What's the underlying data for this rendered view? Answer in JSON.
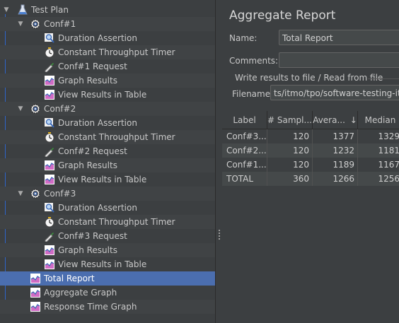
{
  "tree": {
    "items": [
      {
        "label": "Test Plan",
        "icon": "flask-icon",
        "level": 0,
        "expanded": true
      },
      {
        "label": "Conf#1",
        "icon": "gear-icon",
        "level": 1,
        "expanded": true
      },
      {
        "label": "Duration Assertion",
        "icon": "magnifier-icon",
        "level": 2
      },
      {
        "label": "Constant Throughput Timer",
        "icon": "stopwatch-icon",
        "level": 2
      },
      {
        "label": "Conf#1 Request",
        "icon": "pipette-icon",
        "level": 2
      },
      {
        "label": "Graph Results",
        "icon": "graph-icon",
        "level": 2
      },
      {
        "label": "View Results in Table",
        "icon": "graph-icon",
        "level": 2
      },
      {
        "label": "Conf#2",
        "icon": "gear-icon",
        "level": 1,
        "expanded": true
      },
      {
        "label": "Duration Assertion",
        "icon": "magnifier-icon",
        "level": 2
      },
      {
        "label": "Constant Throughput Timer",
        "icon": "stopwatch-icon",
        "level": 2
      },
      {
        "label": "Conf#2 Request",
        "icon": "pipette-icon",
        "level": 2
      },
      {
        "label": "Graph Results",
        "icon": "graph-icon",
        "level": 2
      },
      {
        "label": "View Results in Table",
        "icon": "graph-icon",
        "level": 2
      },
      {
        "label": "Conf#3",
        "icon": "gear-icon",
        "level": 1,
        "expanded": true
      },
      {
        "label": "Duration Assertion",
        "icon": "magnifier-icon",
        "level": 2
      },
      {
        "label": "Constant Throughput Timer",
        "icon": "stopwatch-icon",
        "level": 2
      },
      {
        "label": "Conf#3 Request",
        "icon": "pipette-icon",
        "level": 2
      },
      {
        "label": "Graph Results",
        "icon": "graph-icon",
        "level": 2
      },
      {
        "label": "View Results in Table",
        "icon": "graph-icon",
        "level": 2
      },
      {
        "label": "Total Report",
        "icon": "graph-icon",
        "level": 1,
        "selected": true
      },
      {
        "label": "Aggregate Graph",
        "icon": "graph-icon",
        "level": 1
      },
      {
        "label": "Response Time Graph",
        "icon": "graph-icon",
        "level": 1
      }
    ]
  },
  "panel": {
    "title": "Aggregate Report",
    "name_label": "Name:",
    "name_value": "Total Report",
    "comments_label": "Comments:",
    "comments_value": "",
    "file_group_label": "Write results to file / Read from file",
    "filename_label": "Filename",
    "filename_value": "ts/itmo/tpo/software-testing-itmo"
  },
  "table": {
    "columns": [
      "Label",
      "# Sampl...",
      "Avera...",
      "Median"
    ],
    "sort_indicator": "↓",
    "rows": [
      {
        "label": "Conf#3...",
        "samples": "120",
        "average": "1377",
        "median": "1329"
      },
      {
        "label": "Conf#2...",
        "samples": "120",
        "average": "1232",
        "median": "1181"
      },
      {
        "label": "Conf#1...",
        "samples": "120",
        "average": "1189",
        "median": "1167"
      },
      {
        "label": "TOTAL",
        "samples": "360",
        "average": "1266",
        "median": "1256"
      }
    ]
  },
  "colors": {
    "background": "#3c3f41",
    "selection": "#4b6eaf",
    "tree_line": "#2f65ca"
  }
}
